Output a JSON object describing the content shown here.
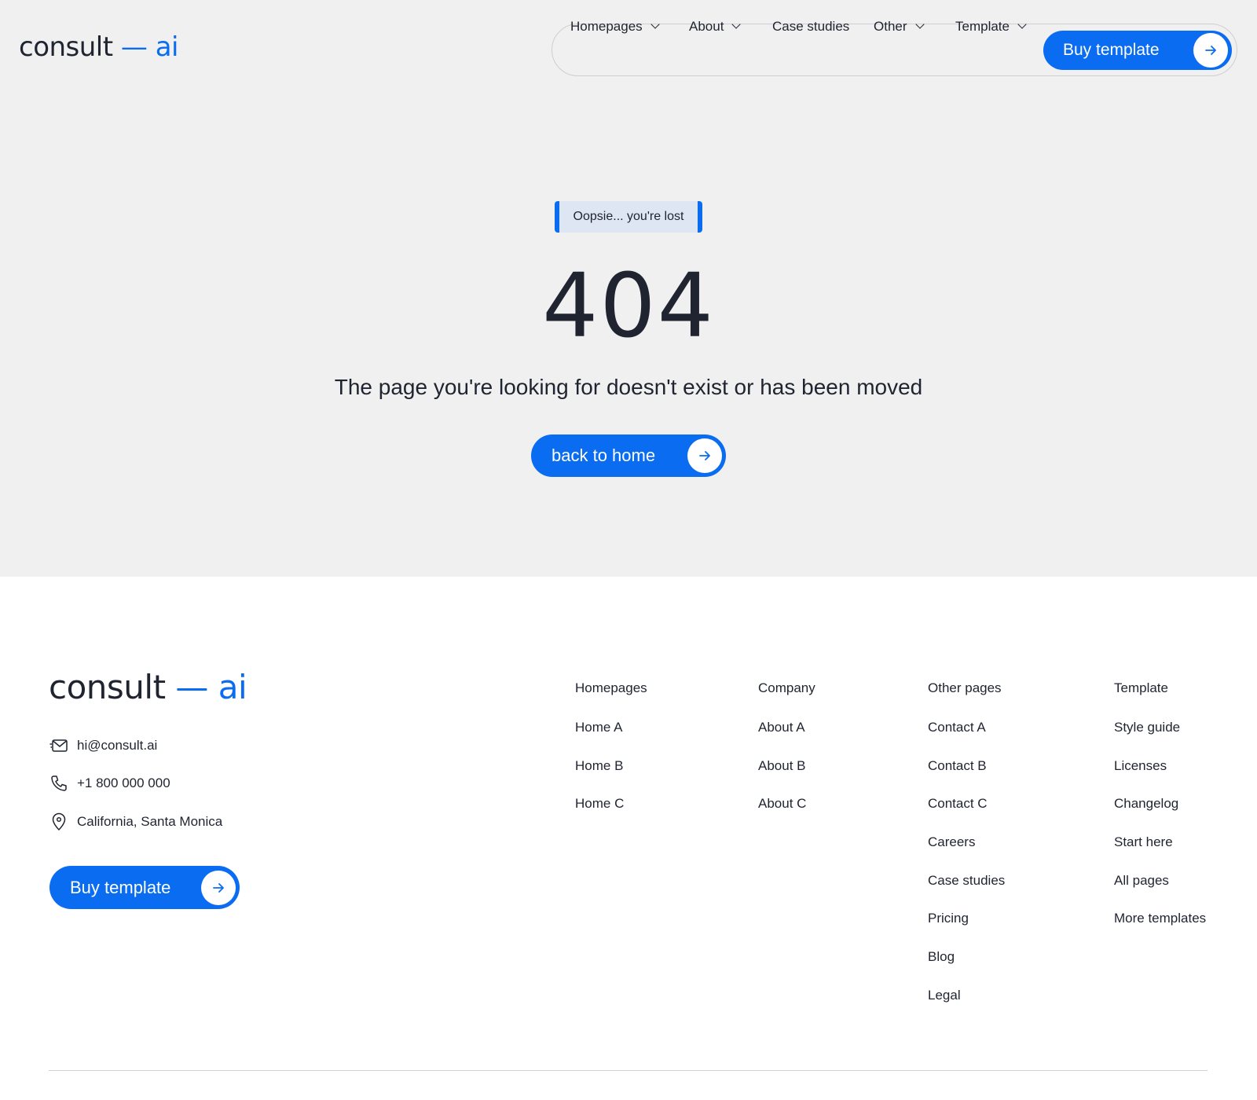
{
  "header": {
    "logo": {
      "word": "consult",
      "dash": "—",
      "accent": "ai"
    },
    "nav": [
      {
        "label": "Homepages",
        "dropdown": true
      },
      {
        "label": "About",
        "dropdown": true
      },
      {
        "label": "Case studies",
        "dropdown": false
      },
      {
        "label": "Other",
        "dropdown": true
      },
      {
        "label": "Template",
        "dropdown": true
      }
    ],
    "buy_button": "Buy template"
  },
  "hero": {
    "badge": "Oopsie... you're lost",
    "code": "404",
    "message": "The page you're looking for doesn't exist or has been moved",
    "home_button": "back to home"
  },
  "footer": {
    "logo": {
      "word": "consult",
      "dash": "—",
      "accent": "ai"
    },
    "contacts": [
      {
        "icon": "mail-icon",
        "text": "hi@consult.ai"
      },
      {
        "icon": "phone-icon",
        "text": "+1 800 000 000"
      },
      {
        "icon": "location-pin-icon",
        "text": "California, Santa Monica"
      }
    ],
    "buy_button": "Buy template",
    "columns": [
      {
        "heading": "Homepages",
        "links": [
          "Home A",
          "Home B",
          "Home C"
        ]
      },
      {
        "heading": "Company",
        "links": [
          "About A",
          "About B",
          "About C"
        ]
      },
      {
        "heading": "Other pages",
        "links": [
          "Contact A",
          "Contact B",
          "Contact C",
          "Careers",
          "Case studies",
          "Pricing",
          "Blog",
          "Legal"
        ]
      },
      {
        "heading": "Template",
        "links": [
          "Style guide",
          "Licenses",
          "Changelog",
          "Start here",
          "All pages",
          "More templates"
        ]
      }
    ]
  },
  "colors": {
    "accent": "#0a6cf0",
    "text": "#1f2430",
    "hero_background": "#f0f0f0",
    "footer_background": "#ffffff"
  }
}
